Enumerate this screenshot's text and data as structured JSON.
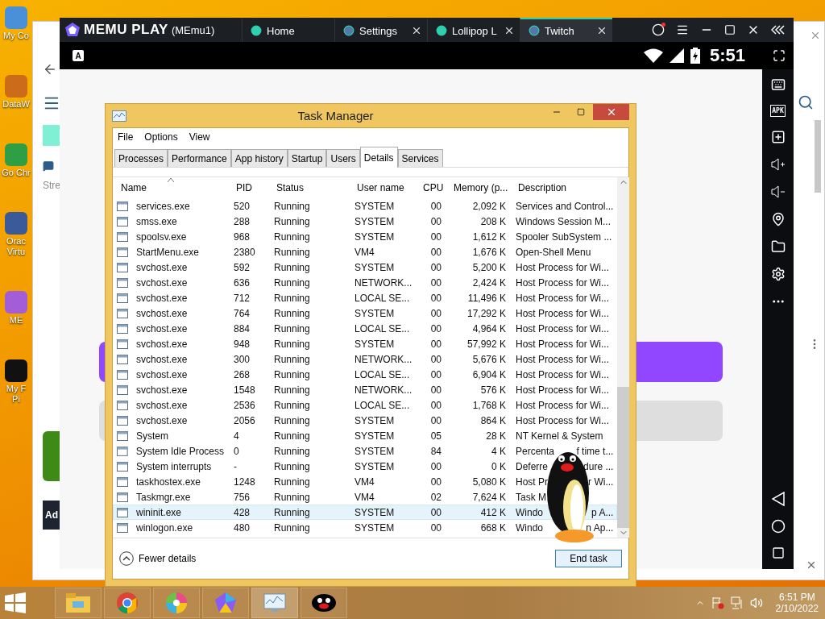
{
  "desktop_icons": [
    {
      "label": "My Co"
    },
    {
      "label": "DataW"
    },
    {
      "label": "Go Chr"
    },
    {
      "label": "Orac Virtu"
    },
    {
      "label": "ME"
    },
    {
      "label": "My F Pi"
    }
  ],
  "browser": {
    "page_text": "Stre",
    "ad_label": "Ad"
  },
  "emulator": {
    "brand": "MEMU PLAY",
    "instance": "(MEmu1)",
    "tabs": [
      {
        "label": "Home",
        "selected": false,
        "closable": false
      },
      {
        "label": "Settings",
        "selected": false,
        "closable": true
      },
      {
        "label": "Lollipop L",
        "selected": false,
        "closable": true
      },
      {
        "label": "Twitch",
        "selected": true,
        "closable": true
      }
    ],
    "notification_icon": "A",
    "clock": "5:51",
    "apk_label": "APK"
  },
  "task_manager": {
    "title": "Task Manager",
    "menu": [
      "File",
      "Options",
      "View"
    ],
    "tabs": [
      {
        "label": "Processes",
        "selected": false
      },
      {
        "label": "Performance",
        "selected": false
      },
      {
        "label": "App history",
        "selected": false
      },
      {
        "label": "Startup",
        "selected": false
      },
      {
        "label": "Users",
        "selected": false
      },
      {
        "label": "Details",
        "selected": true
      },
      {
        "label": "Services",
        "selected": false
      }
    ],
    "columns": [
      "Name",
      "PID",
      "Status",
      "User name",
      "CPU",
      "Memory (p...",
      "Description"
    ],
    "rows": [
      {
        "name": "services.exe",
        "pid": "520",
        "status": "Running",
        "user": "SYSTEM",
        "cpu": "00",
        "memory": "2,092 K",
        "description": [
          "Services and Control..."
        ],
        "selected": false
      },
      {
        "name": "smss.exe",
        "pid": "288",
        "status": "Running",
        "user": "SYSTEM",
        "cpu": "00",
        "memory": "208 K",
        "description": [
          "Windows Session M..."
        ],
        "selected": false
      },
      {
        "name": "spoolsv.exe",
        "pid": "968",
        "status": "Running",
        "user": "SYSTEM",
        "cpu": "00",
        "memory": "1,612 K",
        "description": [
          "Spooler SubSystem ..."
        ],
        "selected": false
      },
      {
        "name": "StartMenu.exe",
        "pid": "2380",
        "status": "Running",
        "user": "VM4",
        "cpu": "00",
        "memory": "1,676 K",
        "description": [
          "Open-Shell Menu"
        ],
        "selected": false
      },
      {
        "name": "svchost.exe",
        "pid": "592",
        "status": "Running",
        "user": "SYSTEM",
        "cpu": "00",
        "memory": "5,200 K",
        "description": [
          "Host Process for Wi..."
        ],
        "selected": false
      },
      {
        "name": "svchost.exe",
        "pid": "636",
        "status": "Running",
        "user": "NETWORK...",
        "cpu": "00",
        "memory": "2,424 K",
        "description": [
          "Host Process for Wi..."
        ],
        "selected": false
      },
      {
        "name": "svchost.exe",
        "pid": "712",
        "status": "Running",
        "user": "LOCAL SE...",
        "cpu": "00",
        "memory": "11,496 K",
        "description": [
          "Host Process for Wi..."
        ],
        "selected": false
      },
      {
        "name": "svchost.exe",
        "pid": "764",
        "status": "Running",
        "user": "SYSTEM",
        "cpu": "00",
        "memory": "17,292 K",
        "description": [
          "Host Process for Wi..."
        ],
        "selected": false
      },
      {
        "name": "svchost.exe",
        "pid": "884",
        "status": "Running",
        "user": "LOCAL SE...",
        "cpu": "00",
        "memory": "4,964 K",
        "description": [
          "Host Process for Wi..."
        ],
        "selected": false
      },
      {
        "name": "svchost.exe",
        "pid": "948",
        "status": "Running",
        "user": "SYSTEM",
        "cpu": "00",
        "memory": "57,992 K",
        "description": [
          "Host Process for Wi..."
        ],
        "selected": false
      },
      {
        "name": "svchost.exe",
        "pid": "300",
        "status": "Running",
        "user": "NETWORK...",
        "cpu": "00",
        "memory": "5,676 K",
        "description": [
          "Host Process for Wi..."
        ],
        "selected": false
      },
      {
        "name": "svchost.exe",
        "pid": "268",
        "status": "Running",
        "user": "LOCAL SE...",
        "cpu": "00",
        "memory": "6,904 K",
        "description": [
          "Host Process for Wi..."
        ],
        "selected": false
      },
      {
        "name": "svchost.exe",
        "pid": "1548",
        "status": "Running",
        "user": "NETWORK...",
        "cpu": "00",
        "memory": "576 K",
        "description": [
          "Host Process for Wi..."
        ],
        "selected": false
      },
      {
        "name": "svchost.exe",
        "pid": "2536",
        "status": "Running",
        "user": "LOCAL SE...",
        "cpu": "00",
        "memory": "1,768 K",
        "description": [
          "Host Process for Wi..."
        ],
        "selected": false
      },
      {
        "name": "svchost.exe",
        "pid": "2056",
        "status": "Running",
        "user": "SYSTEM",
        "cpu": "00",
        "memory": "864 K",
        "description": [
          "Host Process for Wi..."
        ],
        "selected": false
      },
      {
        "name": "System",
        "pid": "4",
        "status": "Running",
        "user": "SYSTEM",
        "cpu": "05",
        "memory": "28 K",
        "description": [
          "NT Kernel & System"
        ],
        "selected": false
      },
      {
        "name": "System Idle Process",
        "pid": "0",
        "status": "Running",
        "user": "SYSTEM",
        "cpu": "84",
        "memory": "4 K",
        "description": [
          "Percenta",
          "f time t..."
        ],
        "selected": false
      },
      {
        "name": "System interrupts",
        "pid": "-",
        "status": "Running",
        "user": "SYSTEM",
        "cpu": "00",
        "memory": "0 K",
        "description": [
          "Deferre",
          "dure ..."
        ],
        "selected": false
      },
      {
        "name": "taskhostex.exe",
        "pid": "1248",
        "status": "Running",
        "user": "VM4",
        "cpu": "00",
        "memory": "5,080 K",
        "description": [
          "Host Pr",
          "r Wi..."
        ],
        "selected": false
      },
      {
        "name": "Taskmgr.exe",
        "pid": "756",
        "status": "Running",
        "user": "VM4",
        "cpu": "02",
        "memory": "7,624 K",
        "description": [
          "Task M"
        ],
        "selected": false
      },
      {
        "name": "wininit.exe",
        "pid": "428",
        "status": "Running",
        "user": "SYSTEM",
        "cpu": "00",
        "memory": "412 K",
        "description": [
          "Windo",
          "p A..."
        ],
        "selected": true
      },
      {
        "name": "winlogon.exe",
        "pid": "480",
        "status": "Running",
        "user": "SYSTEM",
        "cpu": "00",
        "memory": "668 K",
        "description": [
          "Windo",
          "n Ap..."
        ],
        "selected": false
      }
    ],
    "fewer_details": "Fewer details",
    "end_task": "End task"
  },
  "taskbar": {
    "time": "6:51 PM",
    "date": "2/10/2022"
  }
}
